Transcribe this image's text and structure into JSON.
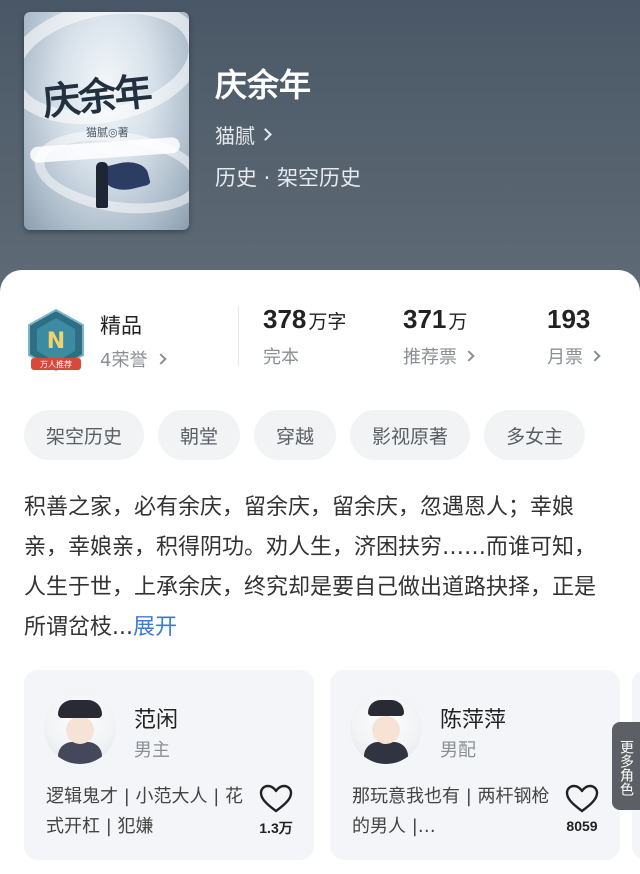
{
  "book": {
    "title": "庆余年",
    "author": "猫腻",
    "category": "历史 · 架空历史",
    "cover_title": "庆余年",
    "cover_author": "猫腻◎著"
  },
  "honor": {
    "name": "精品",
    "count_label": "4荣誉",
    "badge_text": "万人推荐"
  },
  "stats": [
    {
      "value": "378",
      "unit": "万字",
      "label": "完本"
    },
    {
      "value": "371",
      "unit": "万",
      "label": "推荐票"
    },
    {
      "value": "193",
      "unit": "",
      "label": "月票"
    }
  ],
  "tags": [
    "架空历史",
    "朝堂",
    "穿越",
    "影视原著",
    "多女主"
  ],
  "intro": {
    "text": "积善之家，必有余庆，留余庆，留余庆，忽遇恩人；幸娘亲，幸娘亲，积得阴功。劝人生，济困扶穷……而谁可知，人生于世，上承余庆，终究却是要自己做出道路抉择，正是所谓岔枝...",
    "expand_label": "展开"
  },
  "roles": [
    {
      "name": "范闲",
      "type": "男主",
      "desc": "逻辑鬼才 | 小范大人 | 花式开杠 | 犯嫌",
      "likes": "1.3万"
    },
    {
      "name": "陈萍萍",
      "type": "男配",
      "desc": "那玩意我也有 | 两杆钢枪的男人 |…",
      "likes": "8059"
    }
  ],
  "more_roles_label": "更多角色",
  "colors": {
    "header_bg": "#56636f",
    "accent_link": "#3b7bd8",
    "tag_bg": "#f1f3f5",
    "card_bg": "#f3f5f8"
  }
}
